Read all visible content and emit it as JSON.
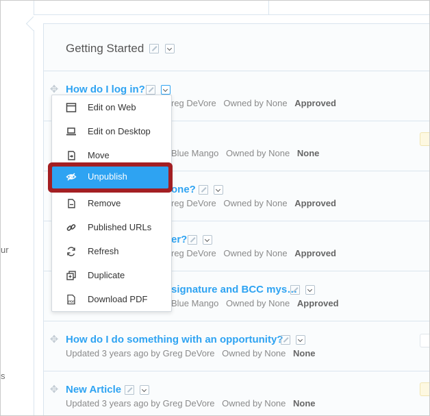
{
  "left_fragments": [
    "ur",
    "s"
  ],
  "section": {
    "title": "Getting Started"
  },
  "articles": [
    {
      "title": "How do I log in?",
      "meta": "Updated 3 years ago by Greg DeVore",
      "owner": "Owned by None",
      "status": "Approved"
    },
    {
      "title": "",
      "meta": "Updated 3 years ago by Blue Mango",
      "owner": "Owned by None",
      "status": "None"
    },
    {
      "title": "How do I add someone?",
      "meta": "Updated 3 years ago by Greg DeVore",
      "owner": "Owned by None",
      "status": "Approved"
    },
    {
      "title": "How do I change my picture or password?",
      "meta": "Updated 3 years ago by Greg DeVore",
      "owner": "Owned by None",
      "status": "Approved"
    },
    {
      "title": "How do I set up my signature and BCC mys…",
      "meta": "Updated 3 years ago by Blue Mango",
      "owner": "Owned by None",
      "status": "Approved"
    },
    {
      "title": "How do I do something with an opportunity?",
      "meta": "Updated 3 years ago by Greg DeVore",
      "owner": "Owned by None",
      "status": "None"
    },
    {
      "title": "New Article",
      "meta": "Updated 3 years ago by Greg DeVore",
      "owner": "Owned by None",
      "status": "None"
    }
  ],
  "visible_fragments": {
    "row1_meta": "reg DeVore",
    "row2_meta": "Blue Mango",
    "row3_title": "one?",
    "row3_meta": "reg DeVore",
    "row4_title": "er?",
    "row4_meta": "reg DeVore",
    "row5_title": "signature and BCC mys…",
    "row5_meta": "Blue Mango"
  },
  "menu": {
    "items": [
      {
        "label": "Edit on Web",
        "icon": "browser-window-icon"
      },
      {
        "label": "Edit on Desktop",
        "icon": "laptop-icon"
      },
      {
        "label": "Move",
        "icon": "move-icon"
      },
      {
        "label": "Unpublish",
        "icon": "eye-slash-icon",
        "highlighted": true
      },
      {
        "label": "Remove",
        "icon": "document-minus-icon"
      },
      {
        "label": "Published URLs",
        "icon": "link-icon"
      },
      {
        "label": "Refresh",
        "icon": "refresh-icon"
      },
      {
        "label": "Duplicate",
        "icon": "duplicate-icon"
      },
      {
        "label": "Download PDF",
        "icon": "pdf-icon"
      }
    ]
  },
  "colors": {
    "link": "#2ea3f2",
    "highlight": "#2ea3f2",
    "callout": "#a31f23"
  }
}
